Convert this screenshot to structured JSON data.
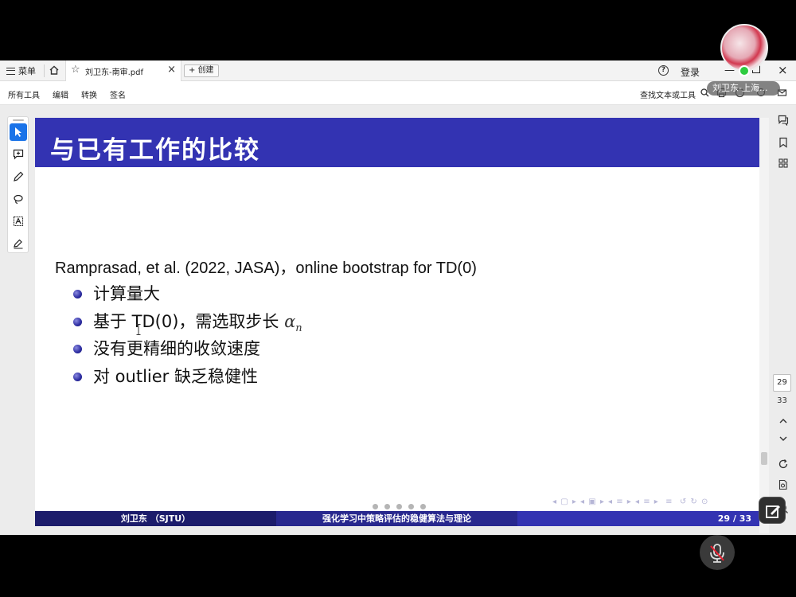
{
  "tabbar": {
    "menu_label": "菜单",
    "doc_tab_title": "刘卫东-南审.pdf",
    "new_tab_label": "+ 创建",
    "login_label": "登录"
  },
  "toolbar": {
    "items": [
      "所有工具",
      "编辑",
      "转换",
      "签名"
    ],
    "search_label": "查找文本或工具"
  },
  "video": {
    "participant_name": "刘卫东-上海..."
  },
  "slide": {
    "title": "与已有工作的比较",
    "reference": "Ramprasad, et al. (2022, JASA)，online bootstrap for TD(0)",
    "bullets": [
      "计算量大",
      "基于 TD(0)，需选取步长 ",
      "没有更精细的收敛速度",
      "对 outlier 缺乏稳健性"
    ],
    "bullet2_math": "α",
    "bullet2_sub": "n",
    "footer": {
      "author": "刘卫东 （SJTU）",
      "talk_title": "强化学习中策略评估的稳健算法与理论",
      "page": "29 / 33"
    }
  },
  "pager": {
    "current": "29",
    "total": "33"
  },
  "colors": {
    "slide_header": "#3333b2",
    "footer_left": "#1c1c6b",
    "footer_mid": "#28288e",
    "active_tool": "#1a73e8"
  }
}
